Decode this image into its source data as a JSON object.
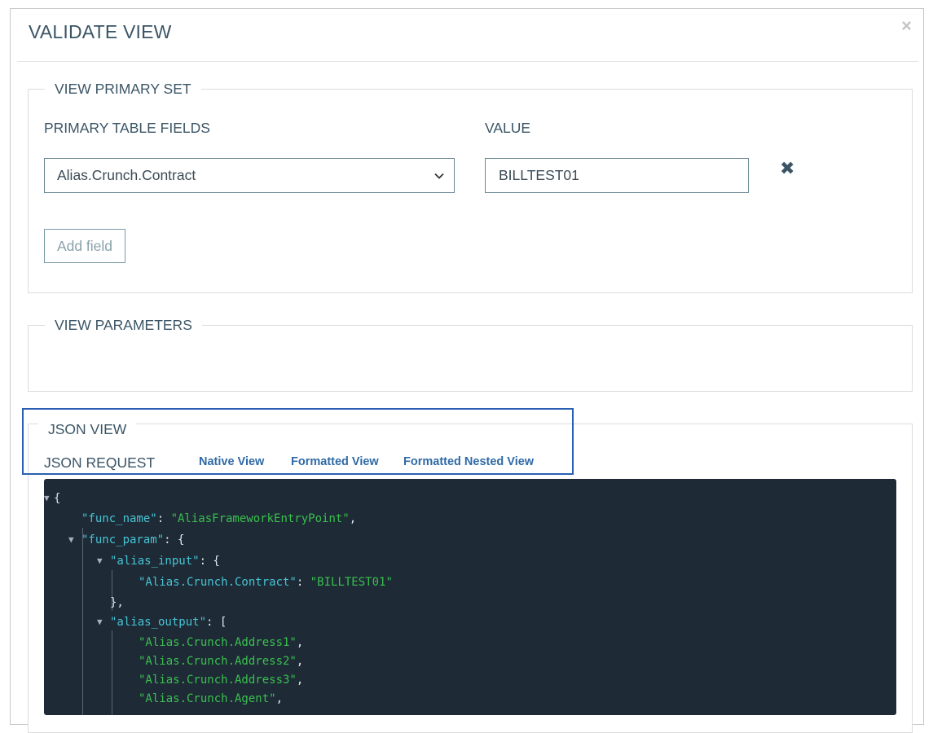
{
  "modal": {
    "title": "VALIDATE VIEW",
    "close_glyph": "×"
  },
  "primary_set": {
    "legend": "VIEW PRIMARY SET",
    "fields_label": "PRIMARY TABLE FIELDS",
    "value_label": "VALUE",
    "selected_field": "Alias.Crunch.Contract",
    "value": "BILLTEST01",
    "remove_glyph": "✖",
    "add_button": "Add field"
  },
  "parameters": {
    "legend": "VIEW PARAMETERS"
  },
  "json_view": {
    "legend": "JSON VIEW",
    "request_label": "JSON REQUEST",
    "links": [
      "Native View",
      "Formatted View",
      "Formatted Nested View"
    ]
  },
  "json_code": {
    "open_brace": "{",
    "func_name_key": "\"func_name\"",
    "func_name_value": "\"AliasFrameworkEntryPoint\"",
    "func_param_key": "\"func_param\"",
    "alias_input_key": "\"alias_input\"",
    "contract_key": "\"Alias.Crunch.Contract\"",
    "contract_value": "\"BILLTEST01\"",
    "close_obj": "},",
    "alias_output_key": "\"alias_output\"",
    "outputs": [
      "\"Alias.Crunch.Address1\"",
      "\"Alias.Crunch.Address2\"",
      "\"Alias.Crunch.Address3\"",
      "\"Alias.Crunch.Agent\""
    ],
    "colon_sep": ": ",
    "comma": ",",
    "obj_open": ": {",
    "arr_open": ": ["
  },
  "colors": {
    "title": "#3b5566",
    "link": "#2f6aa6",
    "code_bg": "#1e2a36",
    "json_key": "#47c4d4",
    "json_string": "#39c04e",
    "highlight": "#2a5fb4"
  }
}
